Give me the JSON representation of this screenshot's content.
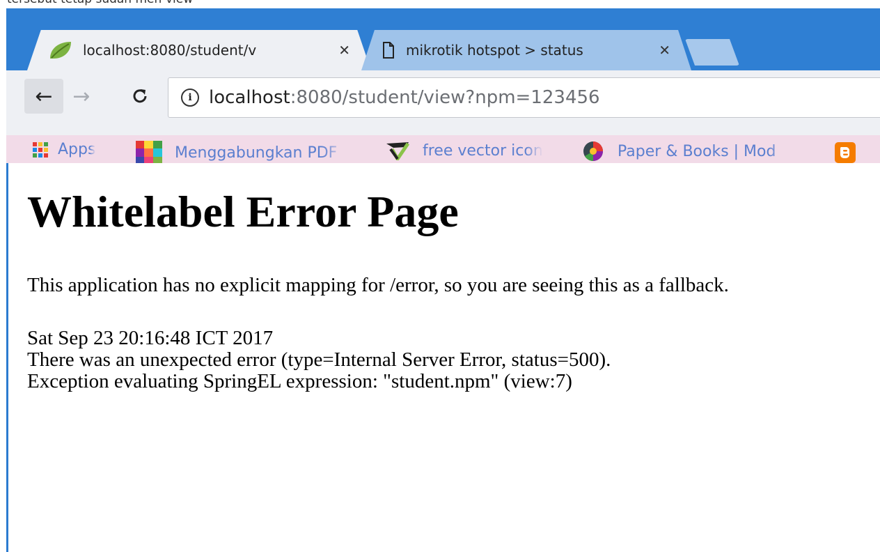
{
  "top_caption": "tersebut tetap sudah meñ-view",
  "tabs": [
    {
      "title": "localhost:8080/student/v",
      "icon": "spring-leaf-icon",
      "active": true
    },
    {
      "title": "mikrotik hotspot > status",
      "icon": "document-icon",
      "active": false
    }
  ],
  "nav": {
    "back": "←",
    "forward": "→",
    "reload": "C"
  },
  "omnibox": {
    "host": "localhost",
    "path": ":8080/student/view?npm=123456"
  },
  "bookmarks": [
    {
      "label": "Apps",
      "icon": "apps-grid-icon"
    },
    {
      "label": "Menggabungkan PDF",
      "icon": "color-grid-icon"
    },
    {
      "label": "free vector icon",
      "icon": "vector-check-icon"
    },
    {
      "label": "Paper & Books | Mod",
      "icon": "globe-colorful-icon"
    },
    {
      "label": "",
      "icon": "blogger-icon"
    }
  ],
  "page": {
    "heading": "Whitelabel Error Page",
    "intro": "This application has no explicit mapping for /error, so you are seeing this as a fallback.",
    "timestamp": "Sat Sep 23 20:16:48 ICT 2017",
    "error_line": "There was an unexpected error (type=Internal Server Error, status=500).",
    "exception_line": "Exception evaluating SpringEL expression: \"student.npm\" (view:7)"
  },
  "colors": {
    "frame": "#2b7bd0",
    "bookmark_bar": "#f2dbe8",
    "link": "#5b7fcf"
  }
}
